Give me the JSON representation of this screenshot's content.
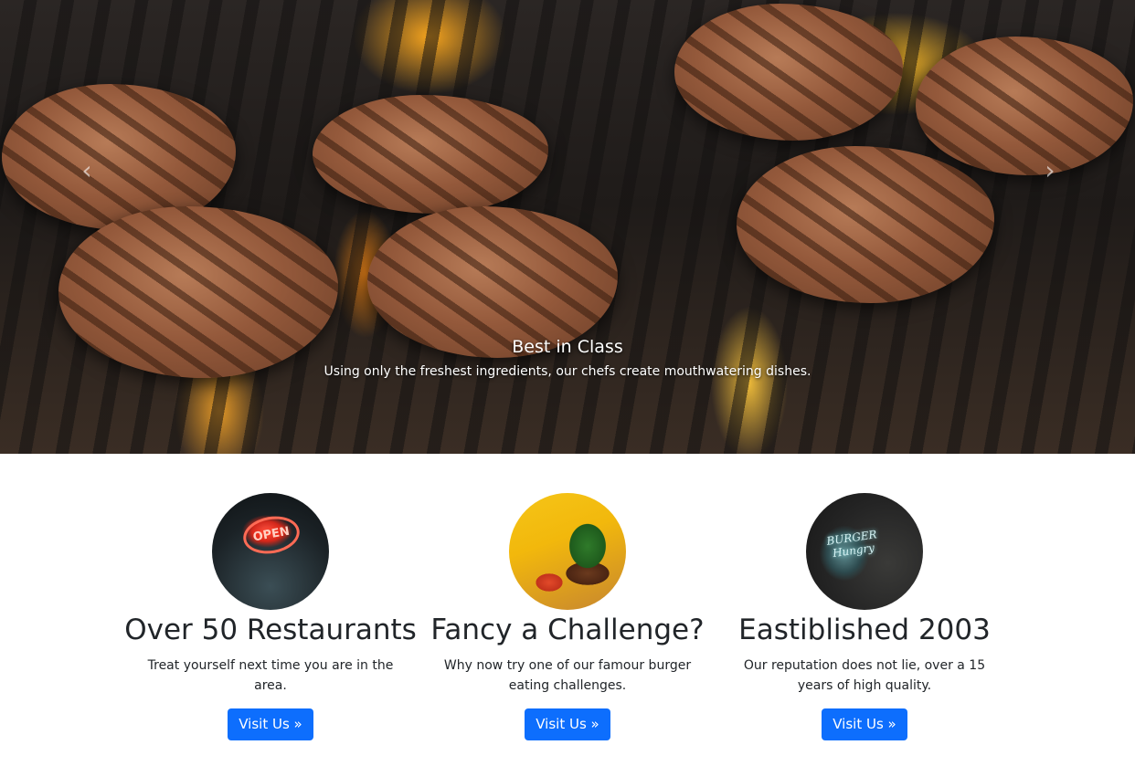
{
  "carousel": {
    "caption_title": "Best in Class",
    "caption_text": "Using only the freshest ingredients, our chefs create mouthwatering dishes.",
    "prev_icon": "chevron-left-icon",
    "next_icon": "chevron-right-icon"
  },
  "features": [
    {
      "image": "open-sign-photo",
      "sign_text": "OPEN",
      "title": "Over 50 Restaurants",
      "text": "Treat yourself next time you are in the area.",
      "button_label": "Visit Us »"
    },
    {
      "image": "burger-challenge-photo",
      "title": "Fancy a Challenge?",
      "text": "Why now try one of our famour burger eating challenges.",
      "button_label": "Visit Us »"
    },
    {
      "image": "neon-burger-sign-photo",
      "sign_text": "BURGER Hungry",
      "title": "Eastiblished 2003",
      "text": "Our reputation does not lie, over a 15 years of high quality.",
      "button_label": "Visit Us »"
    }
  ],
  "colors": {
    "button_bg": "#0d6efd",
    "button_text": "#ffffff",
    "heading_text": "#212529"
  }
}
